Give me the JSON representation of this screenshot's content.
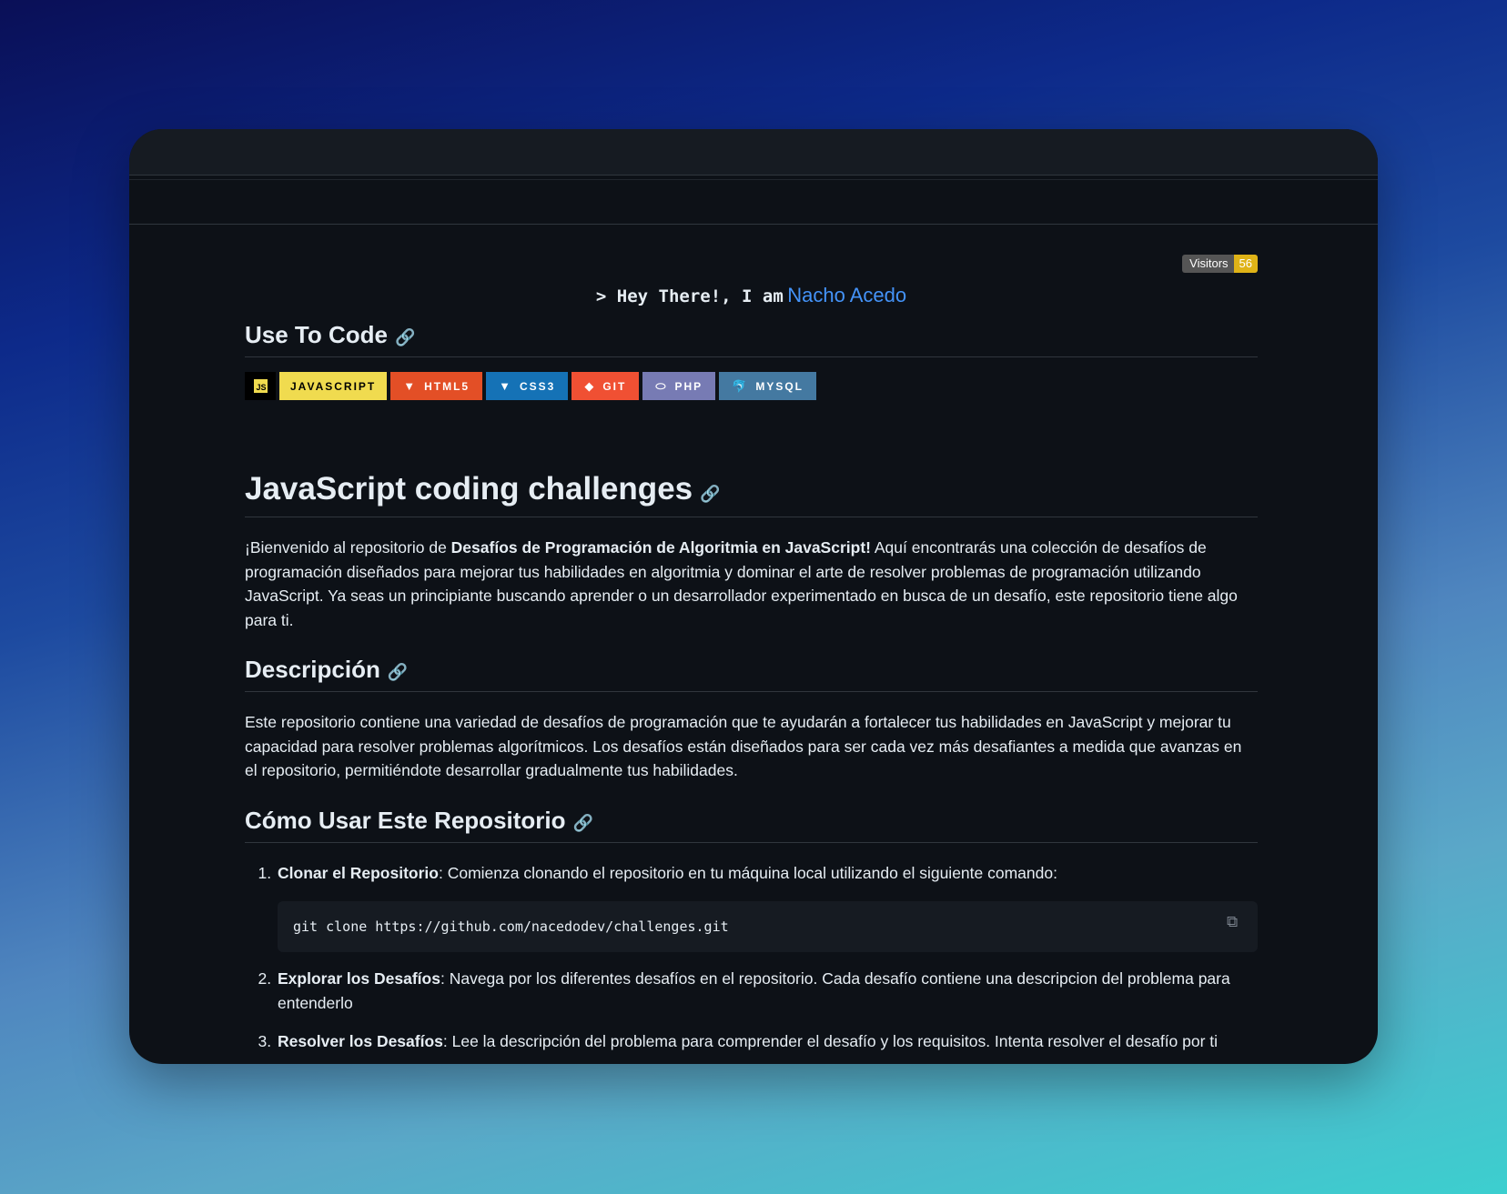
{
  "visitors": {
    "label": "Visitors",
    "count": "56"
  },
  "hey": {
    "prefix": "> Hey There!, I am",
    "name": "Nacho Acedo"
  },
  "use_to_code": {
    "heading": "Use To Code",
    "js_logo": "JS",
    "badges": [
      {
        "label": "JAVASCRIPT",
        "bg": "#f7df1e",
        "fg": "#000000",
        "icon": "javascript-icon"
      },
      {
        "label": "HTML5",
        "bg": "#e34f26",
        "fg": "#ffffff",
        "icon": "html5-icon"
      },
      {
        "label": "CSS3",
        "bg": "#1572b6",
        "fg": "#ffffff",
        "icon": "css3-icon"
      },
      {
        "label": "GIT",
        "bg": "#f05033",
        "fg": "#ffffff",
        "icon": "git-icon"
      },
      {
        "label": "PHP",
        "bg": "#777bb4",
        "fg": "#ffffff",
        "icon": "php-icon"
      },
      {
        "label": "MYSQL",
        "bg": "#4479a1",
        "fg": "#ffffff",
        "icon": "mysql-icon"
      }
    ]
  },
  "challenges": {
    "heading": "JavaScript coding challenges",
    "intro_pre": "¡Bienvenido al repositorio de ",
    "intro_bold": "Desafíos de Programación de Algoritmia en JavaScript!",
    "intro_post": " Aquí encontrarás una colección de desafíos de programación diseñados para mejorar tus habilidades en algoritmia y dominar el arte de resolver problemas de programación utilizando JavaScript. Ya seas un principiante buscando aprender o un desarrollador experimentado en busca de un desafío, este repositorio tiene algo para ti."
  },
  "descripcion": {
    "heading": "Descripción",
    "text": "Este repositorio contiene una variedad de desafíos de programación que te ayudarán a fortalecer tus habilidades en JavaScript y mejorar tu capacidad para resolver problemas algorítmicos. Los desafíos están diseñados para ser cada vez más desafiantes a medida que avanzas en el repositorio, permitiéndote desarrollar gradualmente tus habilidades."
  },
  "como_usar": {
    "heading": "Cómo Usar Este Repositorio",
    "steps": [
      {
        "title": "Clonar el Repositorio",
        "text": ": Comienza clonando el repositorio en tu máquina local utilizando el siguiente comando:"
      },
      {
        "title": "Explorar los Desafíos",
        "text": ": Navega por los diferentes desafíos en el repositorio. Cada desafío contiene una descripcion del problema para entenderlo"
      },
      {
        "title": "Resolver los Desafíos",
        "text": ": Lee la descripción del problema para comprender el desafío y los requisitos. Intenta resolver el desafío por ti"
      }
    ],
    "code": "git clone https://github.com/nacedodev/challenges.git"
  }
}
